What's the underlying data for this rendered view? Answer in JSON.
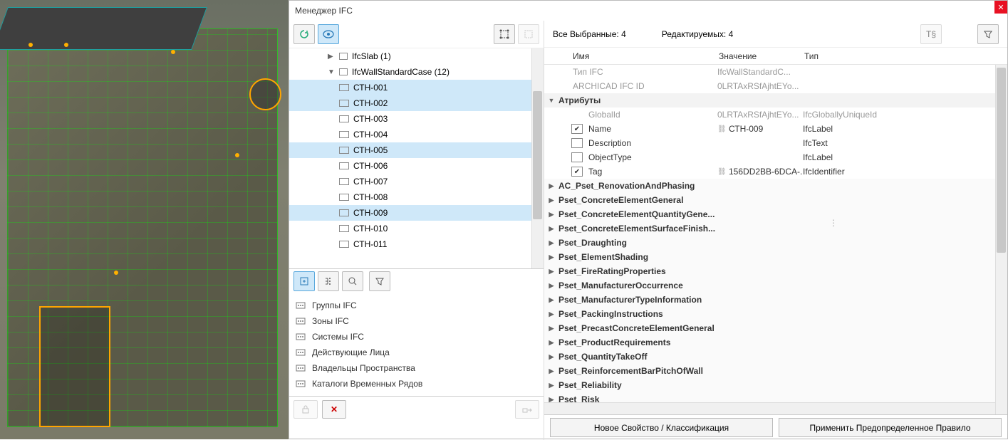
{
  "title": "Менеджер IFC",
  "tree": {
    "slab": {
      "label": "IfcSlab (1)"
    },
    "wall": {
      "label": "IfcWallStandardCase (12)"
    },
    "items": [
      {
        "label": "СТН-001",
        "sel": true
      },
      {
        "label": "СТН-002",
        "sel": true
      },
      {
        "label": "СТН-003",
        "sel": false
      },
      {
        "label": "СТН-004",
        "sel": false
      },
      {
        "label": "СТН-005",
        "sel": true
      },
      {
        "label": "СТН-006",
        "sel": false
      },
      {
        "label": "СТН-007",
        "sel": false
      },
      {
        "label": "СТН-008",
        "sel": false
      },
      {
        "label": "СТН-009",
        "sel": true
      },
      {
        "label": "СТН-010",
        "sel": false
      },
      {
        "label": "СТН-011",
        "sel": false
      }
    ]
  },
  "bottomList": {
    "items": [
      {
        "label": "Группы IFC"
      },
      {
        "label": "Зоны IFC"
      },
      {
        "label": "Системы IFC"
      },
      {
        "label": "Действующие Лица"
      },
      {
        "label": "Владельцы Пространства"
      },
      {
        "label": "Каталоги Временных Рядов"
      }
    ]
  },
  "status": {
    "selected_label": "Все Выбранные:",
    "selected_count": "4",
    "editable_label": "Редактируемых:",
    "editable_count": "4"
  },
  "propHeader": {
    "c1": "Имя",
    "c2": "Значение",
    "c3": "Тип"
  },
  "props": {
    "typeRow": {
      "name": "Тип IFC",
      "value": "IfcWallStandardC...",
      "type": ""
    },
    "idRow": {
      "name": "ARCHICAD IFC ID",
      "value": "0LRTAxRSfAjhtEYo...",
      "type": ""
    },
    "attrGroup": "Атрибуты",
    "attrs": [
      {
        "name": "GlobalId",
        "value": "0LRTAxRSfAjhtEYo...",
        "type": "IfcGloballyUniqueId",
        "gray": true,
        "checked": null
      },
      {
        "name": "Name",
        "value": "СТН-009",
        "type": "IfcLabel",
        "checked": true,
        "chain": true
      },
      {
        "name": "Description",
        "value": "",
        "type": "IfcText",
        "checked": false
      },
      {
        "name": "ObjectType",
        "value": "",
        "type": "IfcLabel",
        "checked": false
      },
      {
        "name": "Tag",
        "value": "156DD2BB-6DCA-...",
        "type": "IfcIdentifier",
        "checked": true,
        "chain": true
      }
    ],
    "psets": [
      "AC_Pset_RenovationAndPhasing",
      "Pset_ConcreteElementGeneral",
      "Pset_ConcreteElementQuantityGene...",
      "Pset_ConcreteElementSurfaceFinish...",
      "Pset_Draughting",
      "Pset_ElementShading",
      "Pset_FireRatingProperties",
      "Pset_ManufacturerOccurrence",
      "Pset_ManufacturerTypeInformation",
      "Pset_PackingInstructions",
      "Pset_PrecastConcreteElementGeneral",
      "Pset_ProductRequirements",
      "Pset_QuantityTakeOff",
      "Pset_ReinforcementBarPitchOfWall",
      "Pset_Reliability",
      "Pset_Risk"
    ]
  },
  "buttons": {
    "newProp": "Новое Свойство / Классификация",
    "applyRule": "Применить Предопределенное Правило"
  }
}
